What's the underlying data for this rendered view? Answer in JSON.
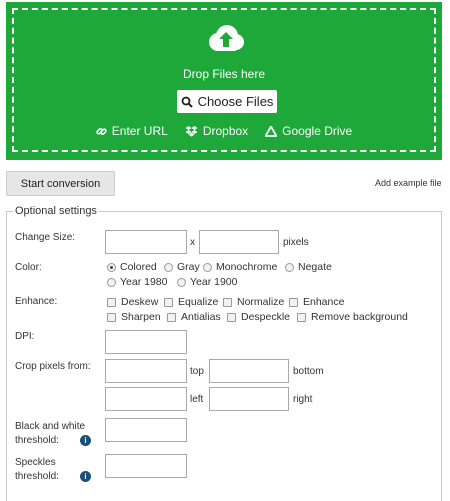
{
  "upload": {
    "drop_text": "Drop Files here",
    "choose_label": "Choose Files",
    "sources": [
      {
        "label": "Enter URL",
        "icon": "link-icon"
      },
      {
        "label": "Dropbox",
        "icon": "dropbox-icon"
      },
      {
        "label": "Google Drive",
        "icon": "google-drive-icon"
      }
    ],
    "colors": {
      "background": "#1fa83a",
      "text": "#ffffff"
    }
  },
  "actions": {
    "start_label": "Start conversion",
    "example_label": "Add example file"
  },
  "settings": {
    "legend": "Optional settings",
    "change_size": {
      "label": "Change Size:",
      "separator": "x",
      "unit": "pixels",
      "width": "",
      "height": ""
    },
    "color": {
      "label": "Color:",
      "options": [
        "Colored",
        "Gray",
        "Monochrome",
        "Negate",
        "Year 1980",
        "Year 1900"
      ],
      "selected": "Colored"
    },
    "enhance": {
      "label": "Enhance:",
      "options": [
        "Deskew",
        "Equalize",
        "Normalize",
        "Enhance",
        "Sharpen",
        "Antialias",
        "Despeckle",
        "Remove background"
      ]
    },
    "dpi": {
      "label": "DPI:",
      "value": ""
    },
    "crop": {
      "label": "Crop pixels from:",
      "top": "top",
      "bottom": "bottom",
      "left": "left",
      "right": "right"
    },
    "bw_threshold": {
      "label_line1": "Black and white",
      "label_line2": "threshold:",
      "value": ""
    },
    "speckles": {
      "label_line1": "Speckles",
      "label_line2": "threshold:",
      "value": ""
    },
    "info_icon": "info-icon",
    "colors": {
      "info": "#1b4f7a"
    }
  }
}
